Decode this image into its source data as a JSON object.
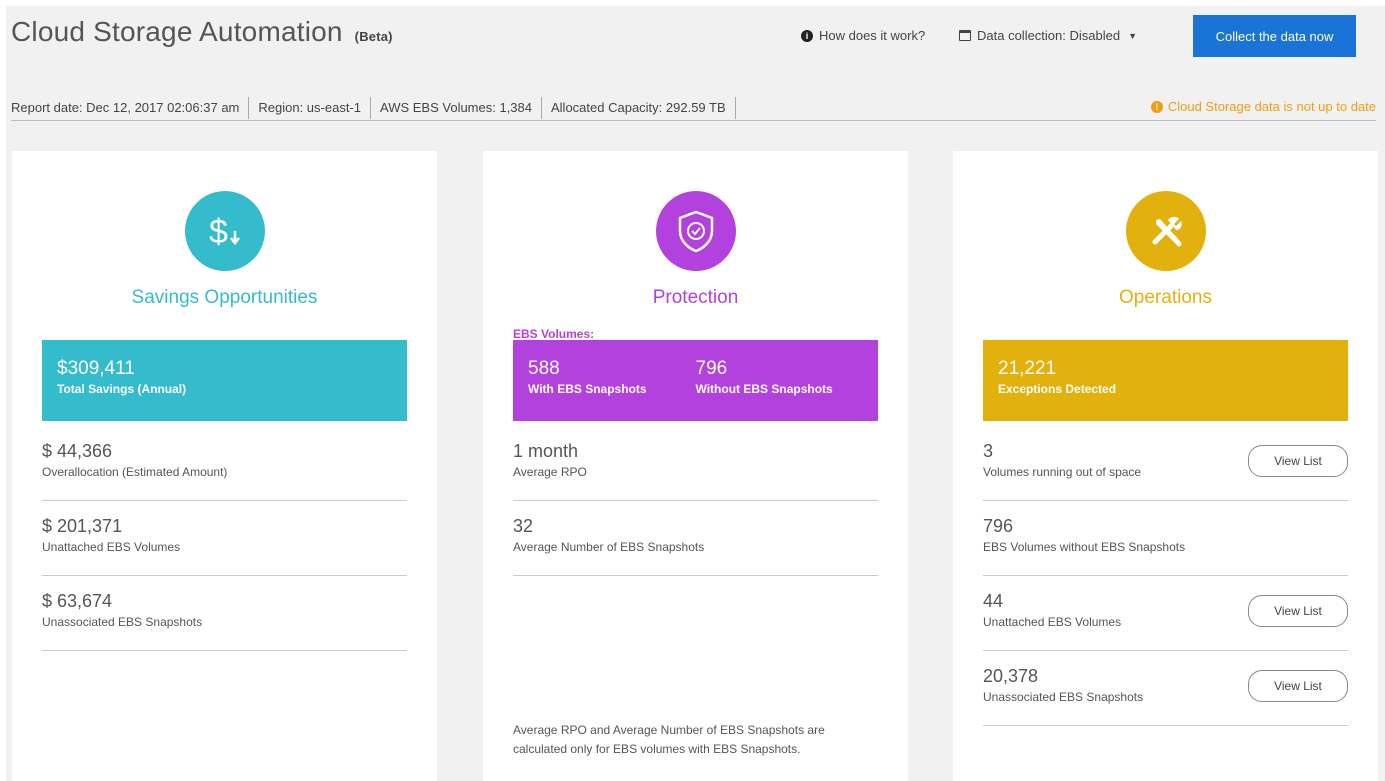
{
  "header": {
    "title": "Cloud Storage Automation",
    "beta": "(Beta)",
    "how_it_works": "How does it work?",
    "data_collection": "Data collection:  Disabled",
    "collect_button": "Collect the data now"
  },
  "infobar": {
    "report_date": "Report date: Dec 12, 2017 02:06:37 am",
    "region": "Region: us-east-1",
    "ebs_volumes": "AWS EBS Volumes: 1,384",
    "allocated_capacity": "Allocated Capacity: 292.59 TB",
    "warning": "Cloud Storage data is not up to date"
  },
  "savings": {
    "title": "Savings Opportunities",
    "color": "#34bccc",
    "banner_value": "$309,411",
    "banner_label": "Total Savings (Annual)",
    "rows": [
      {
        "value": "$ 44,366",
        "label": "Overallocation (Estimated Amount)"
      },
      {
        "value": "$ 201,371",
        "label": "Unattached EBS Volumes"
      },
      {
        "value": "$ 63,674",
        "label": "Unassociated EBS Snapshots"
      }
    ]
  },
  "protection": {
    "title": "Protection",
    "color": "#b341de",
    "sub_label": "EBS Volumes:",
    "banner": [
      {
        "value": "588",
        "label": "With EBS Snapshots"
      },
      {
        "value": "796",
        "label": "Without EBS Snapshots"
      }
    ],
    "rows": [
      {
        "value": "1 month",
        "label": "Average RPO"
      },
      {
        "value": "32",
        "label": "Average Number of EBS Snapshots"
      }
    ],
    "footnote": "Average RPO and Average Number of EBS Snapshots are calculated only for EBS volumes with EBS Snapshots."
  },
  "operations": {
    "title": "Operations",
    "color": "#e3b10d",
    "banner_value": "21,221",
    "banner_label": "Exceptions Detected",
    "view_list": "View List",
    "rows": [
      {
        "value": "3",
        "label": "Volumes running out of space"
      },
      {
        "value": "796",
        "label": "EBS Volumes without EBS Snapshots"
      },
      {
        "value": "44",
        "label": "Unattached EBS Volumes"
      },
      {
        "value": "20,378",
        "label": "Unassociated EBS Snapshots"
      }
    ]
  }
}
